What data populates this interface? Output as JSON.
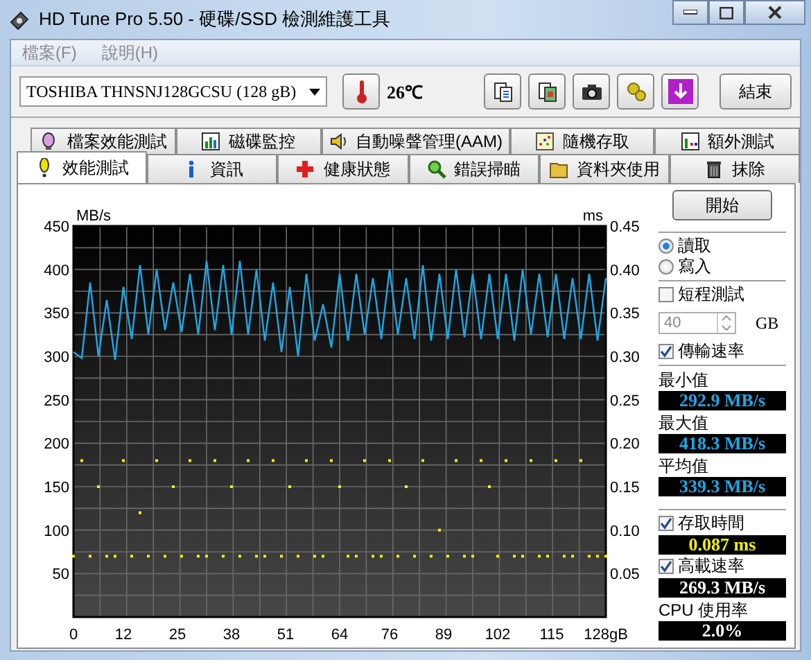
{
  "window": {
    "title": "HD Tune Pro 5.50 - 硬碟/SSD 檢測維護工具"
  },
  "menu": [
    "檔案(F)",
    "說明(H)"
  ],
  "toolbar": {
    "drive": "TOSHIBA THNSNJ128GCSU (128 gB)",
    "temperature": "26℃",
    "exit": "結束"
  },
  "tabs_back": [
    {
      "label": "檔案效能測試",
      "selected": false
    },
    {
      "label": "磁碟監控",
      "selected": false
    },
    {
      "label": "自動噪聲管理(AAM)",
      "selected": false
    },
    {
      "label": "隨機存取",
      "selected": false
    },
    {
      "label": "額外測試",
      "selected": false
    }
  ],
  "tabs_front": [
    {
      "label": "效能測試",
      "selected": true
    },
    {
      "label": "資訊",
      "selected": false
    },
    {
      "label": "健康狀態",
      "selected": false
    },
    {
      "label": "錯誤掃瞄",
      "selected": false
    },
    {
      "label": "資料夾使用",
      "selected": false
    },
    {
      "label": "抹除",
      "selected": false
    }
  ],
  "benchmark": {
    "chart_data": {
      "type": "line",
      "ylabel": "MB/s",
      "y2label": "ms",
      "x": [
        0,
        2,
        4,
        6,
        8,
        10,
        12,
        14,
        16,
        18,
        20,
        22,
        24,
        26,
        28,
        30,
        32,
        34,
        36,
        38,
        40,
        42,
        44,
        46,
        48,
        50,
        52,
        54,
        56,
        58,
        60,
        62,
        64,
        66,
        68,
        70,
        72,
        74,
        76,
        78,
        80,
        82,
        84,
        86,
        88,
        90,
        92,
        94,
        96,
        98,
        100,
        102,
        104,
        106,
        108,
        110,
        112,
        114,
        116,
        118,
        120,
        122,
        124,
        126,
        128
      ],
      "grid": true,
      "xlim": [
        0,
        128
      ],
      "ylim": [
        0,
        450
      ],
      "y2lim": [
        0,
        0.45
      ],
      "xticks": [
        {
          "value": 0,
          "label": "0"
        },
        {
          "value": 12,
          "label": "12"
        },
        {
          "value": 25,
          "label": "25"
        },
        {
          "value": 38,
          "label": "38"
        },
        {
          "value": 51,
          "label": "51"
        },
        {
          "value": 64,
          "label": "64"
        },
        {
          "value": 76,
          "label": "76"
        },
        {
          "value": 89,
          "label": "89"
        },
        {
          "value": 102,
          "label": "102"
        },
        {
          "value": 115,
          "label": "115"
        },
        {
          "value": 128,
          "label": "128gB"
        }
      ],
      "yticks": [
        50,
        100,
        150,
        200,
        250,
        300,
        350,
        400,
        450
      ],
      "y2ticks": [
        {
          "value": 0.05,
          "label": "0.05"
        },
        {
          "value": 0.1,
          "label": "0.10"
        },
        {
          "value": 0.15,
          "label": "0.15"
        },
        {
          "value": 0.2,
          "label": "0.20"
        },
        {
          "value": 0.25,
          "label": "0.25"
        },
        {
          "value": 0.3,
          "label": "0.30"
        },
        {
          "value": 0.35,
          "label": "0.35"
        },
        {
          "value": 0.4,
          "label": "0.40"
        },
        {
          "value": 0.45,
          "label": "0.45"
        }
      ],
      "series": [
        {
          "color": "#1ea8e6",
          "values": [
            305,
            298,
            385,
            300,
            365,
            296,
            380,
            320,
            405,
            325,
            400,
            330,
            385,
            328,
            395,
            325,
            410,
            330,
            405,
            325,
            410,
            325,
            400,
            318,
            385,
            305,
            380,
            300,
            395,
            318,
            360,
            310,
            395,
            318,
            395,
            325,
            390,
            320,
            400,
            325,
            390,
            320,
            405,
            318,
            395,
            320,
            400,
            322,
            395,
            320,
            395,
            320,
            395,
            318,
            400,
            325,
            395,
            322,
            395,
            320,
            390,
            320,
            395,
            318,
            390
          ]
        },
        {
          "color": "#f2f200",
          "axis": "y2",
          "type": "scatter",
          "values": [
            0.07,
            0.18,
            0.07,
            0.15,
            0.07,
            0.07,
            0.18,
            0.07,
            0.12,
            0.07,
            0.18,
            0.07,
            0.15,
            0.07,
            0.18,
            0.07,
            0.07,
            0.18,
            0.07,
            0.15,
            0.07,
            0.18,
            0.07,
            0.07,
            0.18,
            0.07,
            0.15,
            0.07,
            0.18,
            0.07,
            0.07,
            0.18,
            0.15,
            0.07,
            0.07,
            0.18,
            0.07,
            0.07,
            0.18,
            0.07,
            0.15,
            0.07,
            0.18,
            0.07,
            0.1,
            0.07,
            0.18,
            0.07,
            0.07,
            0.18,
            0.15,
            0.07,
            0.18,
            0.07,
            0.07,
            0.18,
            0.07,
            0.07,
            0.18,
            0.07,
            0.07,
            0.18,
            0.07,
            0.07,
            0.07
          ]
        }
      ]
    }
  },
  "controls": {
    "start": "開始",
    "modes": [
      {
        "label": "讀取",
        "selected": true
      },
      {
        "label": "寫入",
        "selected": false
      }
    ],
    "short_test": {
      "label": "短程測試",
      "checked": false
    },
    "size": {
      "value": "40",
      "disabled": true,
      "unit": "GB"
    },
    "transfer": {
      "label": "傳輸速率",
      "checked": true
    },
    "readouts": [
      {
        "label": "最小值",
        "value": "292.9 MB/s"
      },
      {
        "label": "最大值",
        "value": "418.3 MB/s"
      },
      {
        "label": "平均值",
        "value": "339.3 MB/s"
      }
    ],
    "access": {
      "label": "存取時間",
      "checked": true,
      "value": "0.087 ms"
    },
    "burst": {
      "label": "高載速率",
      "checked": true,
      "value": "269.3 MB/s"
    },
    "cpu": {
      "label": "CPU 使用率",
      "value": "2.0%"
    }
  }
}
